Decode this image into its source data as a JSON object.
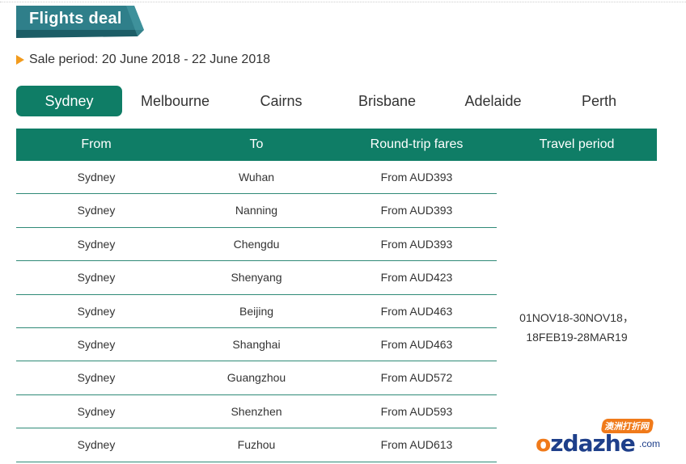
{
  "banner": {
    "title": "Flights deal"
  },
  "sale": {
    "text": "Sale period: 20 June 2018 - 22 June 2018"
  },
  "tabs": [
    "Sydney",
    "Melbourne",
    "Cairns",
    "Brisbane",
    "Adelaide",
    "Perth"
  ],
  "active_tab": "Sydney",
  "table": {
    "headers": [
      "From",
      "To",
      "Round-trip fares",
      "Travel period"
    ],
    "rows": [
      {
        "from": "Sydney",
        "to": "Wuhan",
        "fare": "From AUD393"
      },
      {
        "from": "Sydney",
        "to": "Nanning",
        "fare": "From AUD393"
      },
      {
        "from": "Sydney",
        "to": "Chengdu",
        "fare": "From AUD393"
      },
      {
        "from": "Sydney",
        "to": "Shenyang",
        "fare": "From AUD423"
      },
      {
        "from": "Sydney",
        "to": "Beijing",
        "fare": "From AUD463"
      },
      {
        "from": "Sydney",
        "to": "Shanghai",
        "fare": "From AUD463"
      },
      {
        "from": "Sydney",
        "to": "Guangzhou",
        "fare": "From AUD572"
      },
      {
        "from": "Sydney",
        "to": "Shenzhen",
        "fare": "From AUD593"
      },
      {
        "from": "Sydney",
        "to": "Fuzhou",
        "fare": "From AUD613"
      }
    ],
    "travel_period": [
      "01NOV18-30NOV18，",
      "18FEB19-28MAR19"
    ]
  },
  "watermark": {
    "cn": "澳洲打折网",
    "en_o": "o",
    "en_rest": "zdazhe",
    "com": ".com"
  },
  "colors": {
    "brand": "#0f7d66",
    "accent": "#f29b1d"
  }
}
